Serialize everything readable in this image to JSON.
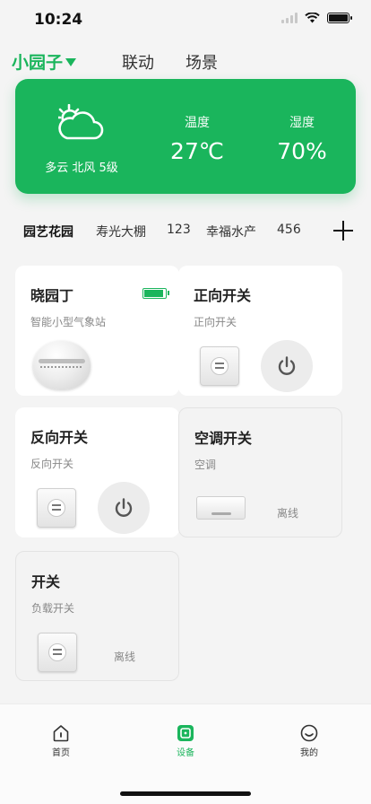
{
  "status_bar": {
    "time": "10:24"
  },
  "top_nav": {
    "home_name": "小园子",
    "tabs": [
      "联动",
      "场景"
    ]
  },
  "weather": {
    "description": "多云 北风 5级",
    "temperature_label": "温度",
    "temperature_value": "27℃",
    "humidity_label": "湿度",
    "humidity_value": "70%"
  },
  "garden_tabs": [
    "园艺花园",
    "寿光大棚",
    "123",
    "幸福水产",
    "456"
  ],
  "devices": [
    {
      "name": "晓园丁",
      "subtitle": "智能小型气象站",
      "battery_level": 0.9
    },
    {
      "name": "正向开关",
      "subtitle": "正向开关"
    },
    {
      "name": "反向开关",
      "subtitle": "反向开关"
    },
    {
      "name": "空调开关",
      "subtitle": "空调",
      "status": "离线"
    },
    {
      "name": "开关",
      "subtitle": "负载开关",
      "status": "离线"
    }
  ],
  "bottom_tabs": {
    "home": "首页",
    "devices": "设备",
    "mine": "我的"
  },
  "colors": {
    "accent": "#1ab55c",
    "background": "#f4f4f4"
  }
}
